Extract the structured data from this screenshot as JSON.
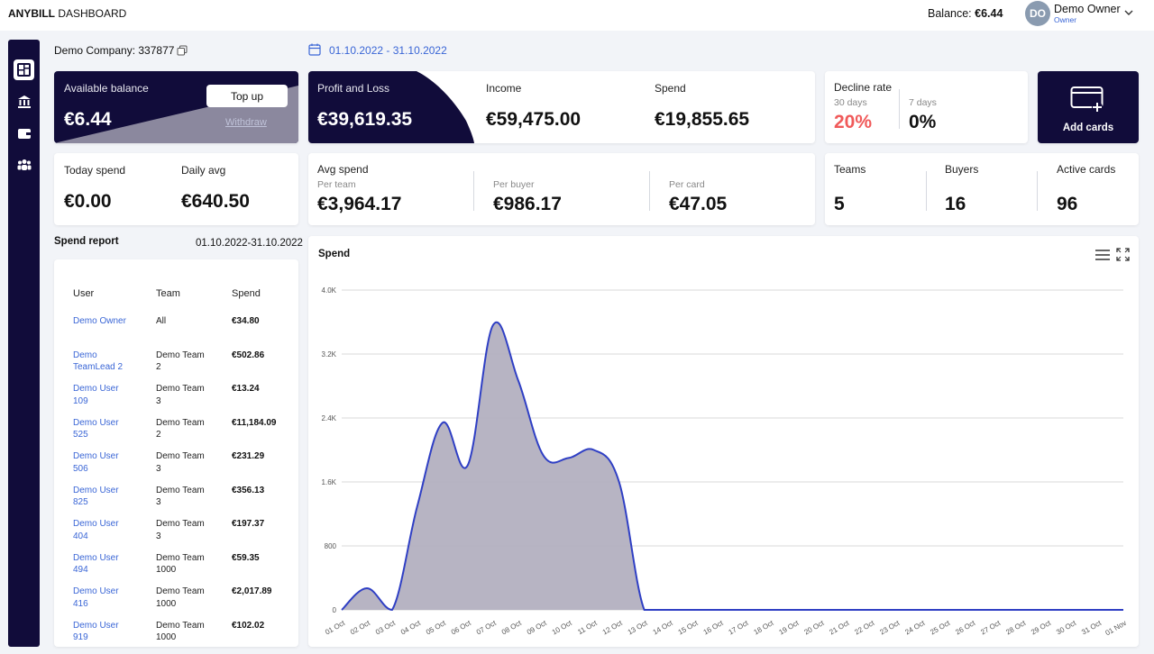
{
  "header": {
    "brand_bold": "ANYBILL",
    "brand_rest": " DASHBOARD",
    "balance_label": "Balance: ",
    "balance_value": "€6.44",
    "user_initials": "DO",
    "user_name": "Demo Owner",
    "user_role": "Owner"
  },
  "sidebar": {
    "items": [
      {
        "icon": "dashboard-icon",
        "active": true
      },
      {
        "icon": "bank-icon",
        "active": false
      },
      {
        "icon": "wallet-icon",
        "active": false
      },
      {
        "icon": "users-icon",
        "active": false
      }
    ]
  },
  "company": "Demo Company: 337877",
  "date_range": "01.10.2022 - 31.10.2022",
  "cards": {
    "available_balance": {
      "label": "Available balance",
      "value": "€6.44",
      "topup_label": "Top up",
      "withdraw_label": "Withdraw"
    },
    "profit_loss": {
      "label": "Profit and Loss",
      "value": "€39,619.35"
    },
    "income": {
      "label": "Income",
      "value": "€59,475.00"
    },
    "spend": {
      "label": "Spend",
      "value": "€19,855.65"
    },
    "decline_rate": {
      "label": "Decline rate",
      "d30_label": "30 days",
      "d30_value": "20%",
      "d7_label": "7 days",
      "d7_value": "0%"
    },
    "add_cards": {
      "label": "Add cards"
    },
    "today_spend": {
      "label": "Today spend",
      "value": "€0.00"
    },
    "daily_avg": {
      "label": "Daily avg",
      "value": "€640.50"
    },
    "avg_spend": {
      "label": "Avg spend",
      "per_team_label": "Per team",
      "per_team_value": "€3,964.17",
      "per_buyer_label": "Per buyer",
      "per_buyer_value": "€986.17",
      "per_card_label": "Per card",
      "per_card_value": "€47.05"
    },
    "teams": {
      "label": "Teams",
      "value": "5"
    },
    "buyers": {
      "label": "Buyers",
      "value": "16"
    },
    "active_cards": {
      "label": "Active cards",
      "value": "96"
    }
  },
  "spend_report": {
    "title": "Spend report",
    "dates": "01.10.2022-31.10.2022",
    "columns": [
      "User",
      "Team",
      "Spend"
    ],
    "rows": [
      {
        "user": [
          "Demo Owner"
        ],
        "team": [
          "All"
        ],
        "spend": "€34.80"
      },
      {
        "user": [
          "Demo",
          "TeamLead 2"
        ],
        "team": [
          "Demo Team",
          "2"
        ],
        "spend": "€502.86"
      },
      {
        "user": [
          "Demo User",
          "109"
        ],
        "team": [
          "Demo Team",
          "3"
        ],
        "spend": "€13.24"
      },
      {
        "user": [
          "Demo User",
          "525"
        ],
        "team": [
          "Demo Team",
          "2"
        ],
        "spend": "€11,184.09"
      },
      {
        "user": [
          "Demo User",
          "506"
        ],
        "team": [
          "Demo Team",
          "3"
        ],
        "spend": "€231.29"
      },
      {
        "user": [
          "Demo User",
          "825"
        ],
        "team": [
          "Demo Team",
          "3"
        ],
        "spend": "€356.13"
      },
      {
        "user": [
          "Demo User",
          "404"
        ],
        "team": [
          "Demo Team",
          "3"
        ],
        "spend": "€197.37"
      },
      {
        "user": [
          "Demo User",
          "494"
        ],
        "team": [
          "Demo Team",
          "1000"
        ],
        "spend": "€59.35"
      },
      {
        "user": [
          "Demo User",
          "416"
        ],
        "team": [
          "Demo Team",
          "1000"
        ],
        "spend": "€2,017.89"
      },
      {
        "user": [
          "Demo User",
          "919"
        ],
        "team": [
          "Demo Team",
          "1000"
        ],
        "spend": "€102.02"
      }
    ]
  },
  "colors": {
    "accent": "#3a66d6",
    "dark": "#110c3a",
    "decline": "#f05a5a",
    "series_line": "#2f3fc4",
    "series_fill": "#b3b0c0"
  },
  "chart_data": {
    "type": "area",
    "title": "Spend",
    "xlabel": "",
    "ylabel": "",
    "ylim": [
      0,
      4000
    ],
    "y_ticks": [
      0,
      800,
      1600,
      2400,
      3200,
      4000
    ],
    "y_tick_labels": [
      "0",
      "800",
      "1.6K",
      "2.4K",
      "3.2K",
      "4.0K"
    ],
    "grid": true,
    "categories": [
      "01 Oct",
      "02 Oct",
      "03 Oct",
      "04 Oct",
      "05 Oct",
      "06 Oct",
      "07 Oct",
      "08 Oct",
      "09 Oct",
      "10 Oct",
      "11 Oct",
      "12 Oct",
      "13 Oct",
      "14 Oct",
      "15 Oct",
      "16 Oct",
      "17 Oct",
      "18 Oct",
      "19 Oct",
      "20 Oct",
      "21 Oct",
      "22 Oct",
      "23 Oct",
      "24 Oct",
      "25 Oct",
      "26 Oct",
      "27 Oct",
      "28 Oct",
      "29 Oct",
      "30 Oct",
      "31 Oct",
      "01 Nov"
    ],
    "series": [
      {
        "values": [
          0,
          270,
          0,
          1300,
          2340,
          1810,
          3560,
          2870,
          1930,
          1900,
          2000,
          1600,
          0,
          0,
          0,
          0,
          0,
          0,
          0,
          0,
          0,
          0,
          0,
          0,
          0,
          0,
          0,
          0,
          0,
          0,
          0,
          0
        ]
      }
    ]
  }
}
